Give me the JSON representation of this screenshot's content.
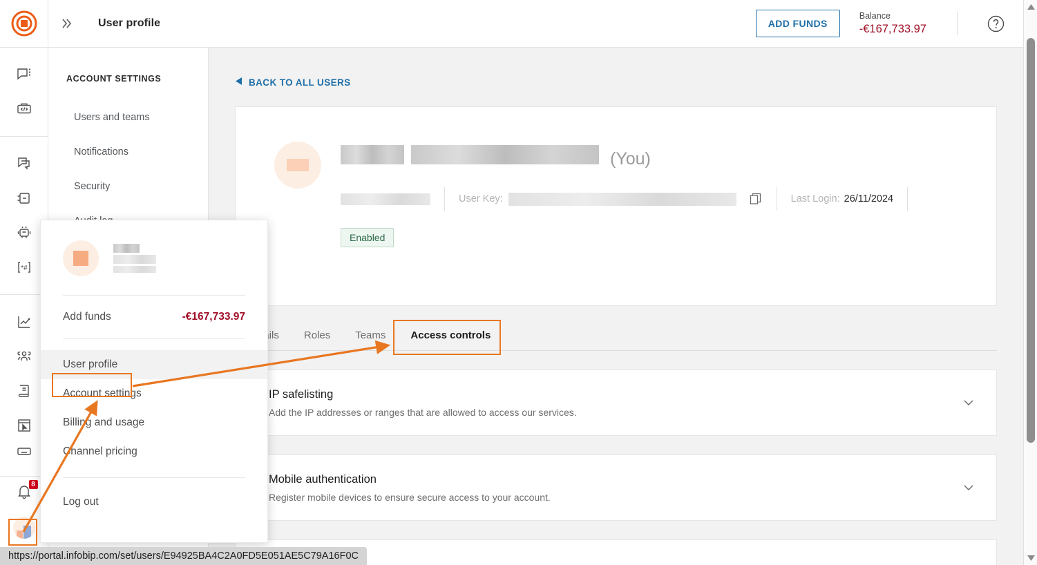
{
  "header": {
    "expand_icon": "chevron-double-right-icon",
    "title": "User profile",
    "add_funds_label": "ADD FUNDS",
    "balance_label": "Balance",
    "balance_value": "-€167,733.97",
    "help_icon": "question-circle-icon"
  },
  "rail": {
    "logo_icon": "infobip-target-logo",
    "icons": [
      {
        "name": "conversations-icon"
      },
      {
        "name": "developer-tools-icon"
      },
      {
        "name": "broadcast-icon"
      },
      {
        "name": "flow-icon"
      },
      {
        "name": "answers-bot-icon"
      },
      {
        "name": "numbers-icon"
      },
      {
        "name": "analytics-icon"
      },
      {
        "name": "people-icon"
      },
      {
        "name": "catalog-icon"
      },
      {
        "name": "forms-icon"
      },
      {
        "name": "keyboard-icon"
      }
    ],
    "bell_icon": "bell-icon",
    "bell_badge": "8",
    "avatar_icon": "user-avatar"
  },
  "settings_nav": {
    "heading": "ACCOUNT SETTINGS",
    "items": [
      {
        "label": "Users and teams"
      },
      {
        "label": "Notifications"
      },
      {
        "label": "Security"
      },
      {
        "label": "Audit log"
      }
    ]
  },
  "main": {
    "back_link": "BACK TO ALL USERS",
    "back_icon": "triangle-left-icon",
    "profile": {
      "name_redacted_1": "",
      "name_redacted_2": "",
      "you_suffix": "(You)",
      "role_redacted": "",
      "user_key_label": "User Key:",
      "user_key_redacted": "",
      "copy_icon": "copy-icon",
      "last_login_label": "Last Login:",
      "last_login_value": "26/11/2024",
      "status": "Enabled"
    },
    "tabs": [
      {
        "label": "Details",
        "active": false
      },
      {
        "label": "Roles",
        "active": false
      },
      {
        "label": "Teams",
        "active": false
      },
      {
        "label": "Access controls",
        "active": true
      }
    ],
    "sections": [
      {
        "title": "IP safelisting",
        "subtitle": "Add the IP addresses or ranges that are allowed to access our services.",
        "chevron": "chevron-down-icon"
      },
      {
        "title": "Mobile authentication",
        "subtitle": "Register mobile devices to ensure secure access to your account.",
        "chevron": "chevron-down-icon"
      }
    ]
  },
  "user_menu": {
    "name_redacted": "",
    "add_funds_label": "Add funds",
    "balance_value": "-€167,733.97",
    "items": [
      {
        "label": "User profile",
        "highlighted": true
      },
      {
        "label": "Account settings",
        "highlighted": false
      },
      {
        "label": "Billing and usage",
        "highlighted": false
      },
      {
        "label": "Channel pricing",
        "highlighted": false
      }
    ],
    "logout_label": "Log out"
  },
  "status_bar": {
    "url": "https://portal.infobip.com/set/users/E94925BA4C2A0FD5E051AE5C79A16F0C"
  },
  "annotation": {
    "color": "#e87722"
  }
}
